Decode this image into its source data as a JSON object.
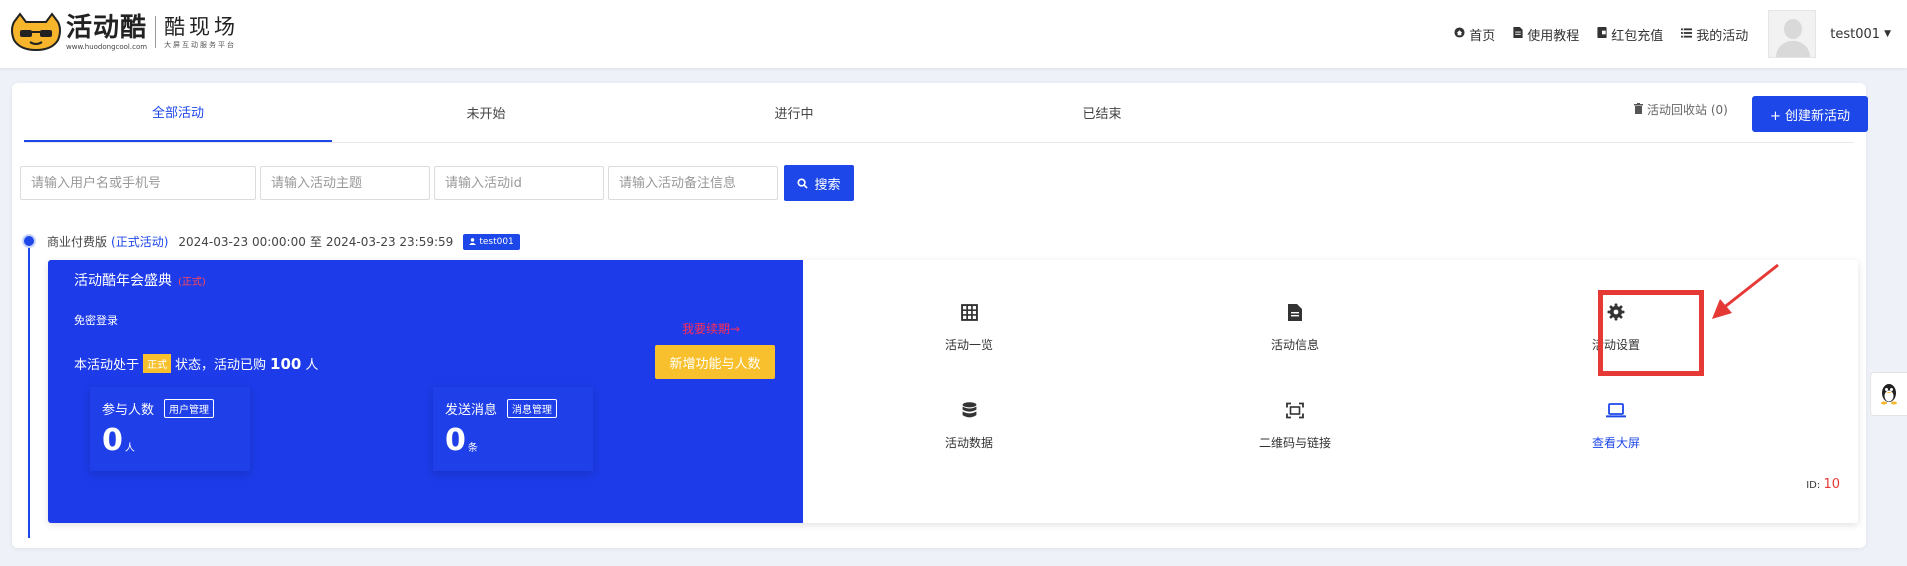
{
  "header": {
    "logo_main": "活动酷",
    "logo_url": "www.huodongcool.com",
    "logo_sub": "酷现场",
    "logo_sub_small": "大屏互动服务平台",
    "nav": [
      {
        "label": "首页",
        "icon": "home-icon"
      },
      {
        "label": "使用教程",
        "icon": "book-icon"
      },
      {
        "label": "红包充值",
        "icon": "wallet-icon"
      },
      {
        "label": "我的活动",
        "icon": "list-icon"
      }
    ],
    "username": "test001"
  },
  "tabs": [
    "全部活动",
    "未开始",
    "进行中",
    "已结束"
  ],
  "active_tab": 0,
  "recycle": {
    "label": "活动回收站",
    "count": "(0)"
  },
  "create_button": "+ 创建新活动",
  "search": {
    "placeholders": [
      "请输入用户名或手机号",
      "请输入活动主题",
      "请输入活动id",
      "请输入活动备注信息"
    ],
    "button": "搜索"
  },
  "event": {
    "plan": "商业付费版",
    "plan_type": "(正式活动)",
    "time_start": "2024-03-23 00:00:00",
    "time_sep": "至",
    "time_end": "2024-03-23 23:59:59",
    "user": "test001",
    "title": "活动酷年会盛典",
    "title_state": "(正式)",
    "login": "免密登录",
    "status_prefix": "本活动处于",
    "status_badge": "正式",
    "status_middle": "状态，活动已购",
    "purchased": "100",
    "purchased_unit": "人",
    "upgrade_link": "我要续期→",
    "upgrade_button": "新增功能与人数",
    "stats": [
      {
        "label": "参与人数",
        "button": "用户管理",
        "value": "0",
        "unit": "人"
      },
      {
        "label": "发送消息",
        "button": "消息管理",
        "value": "0",
        "unit": "条"
      }
    ],
    "actions": [
      {
        "label": "活动一览",
        "icon": "grid-icon"
      },
      {
        "label": "活动信息",
        "icon": "document-icon"
      },
      {
        "label": "活动设置",
        "icon": "gear-icon"
      },
      {
        "label": "活动数据",
        "icon": "database-icon"
      },
      {
        "label": "二维码与链接",
        "icon": "qrcode-scan-icon"
      },
      {
        "label": "查看大屏",
        "icon": "laptop-icon"
      }
    ],
    "id_label": "ID:",
    "id_value": "10"
  },
  "colors": {
    "primary": "#1d47e8",
    "card_blue": "#1d3be8",
    "accent_yellow": "#f7c02c",
    "highlight_red": "#e53935"
  }
}
